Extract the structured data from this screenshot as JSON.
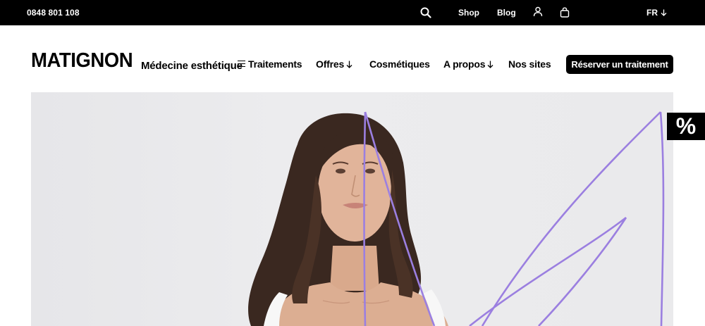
{
  "topbar": {
    "phone": "0848 801 108",
    "shop_label": "Shop",
    "blog_label": "Blog",
    "language": "FR",
    "icons": [
      "search-icon",
      "user-icon",
      "shopping-bag-icon",
      "arrow-down-icon"
    ]
  },
  "header": {
    "logo": "MATIGNON",
    "tagline": "Médecine esthétique",
    "nav": {
      "treatments": "Traitements",
      "offers": "Offres",
      "cosmetics": "Cosmétiques",
      "about": "A propos",
      "sites": "Nos sites"
    },
    "cta_label": "Réserver un traitement"
  },
  "hero": {
    "image": "woman-portrait",
    "accent_color": "#9b7fe0"
  },
  "promo_tab": {
    "label": "%"
  },
  "colors": {
    "topbar_bg": "#000000",
    "page_bg": "#ffffff",
    "hero_bg": "#e8e8ea",
    "line_accent": "#9b7fe0"
  }
}
